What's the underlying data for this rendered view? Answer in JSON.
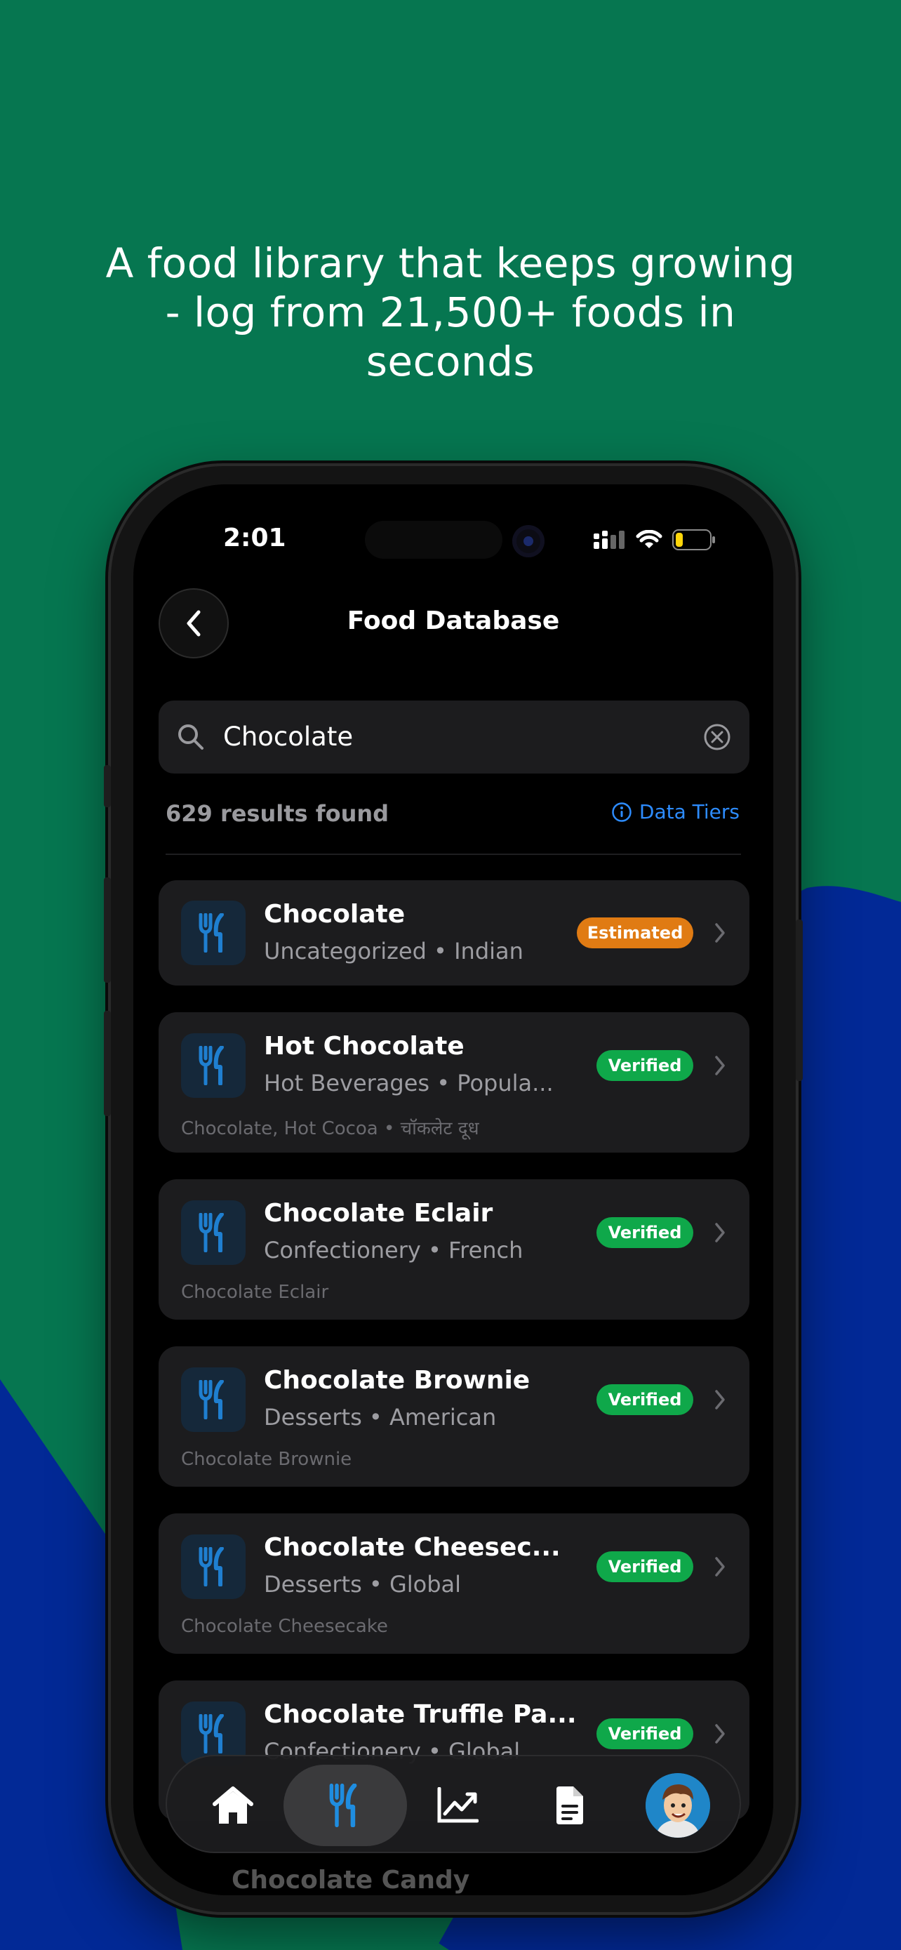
{
  "marketing": {
    "headline": "A food library that keeps growing - log from 21,500+ foods in seconds",
    "colors": {
      "green": "#067650",
      "blue": "#022996"
    }
  },
  "status_bar": {
    "time": "2:01"
  },
  "header": {
    "back_icon": "chevron-left-icon",
    "title": "Food Database"
  },
  "search": {
    "value": "Chocolate",
    "icon": "search-icon",
    "clear_icon": "clear-circle-icon"
  },
  "results": {
    "count_text": "629 results found",
    "data_tiers_label": "Data Tiers"
  },
  "foods": [
    {
      "name": "Chocolate",
      "subtitle": "Uncategorized • Indian",
      "alias": "",
      "badge": "Estimated",
      "badge_color": "#e07b13"
    },
    {
      "name": "Hot Chocolate",
      "subtitle": "Hot Beverages • Popula...",
      "alias": "Chocolate, Hot Cocoa • चॉकलेट दूध",
      "badge": "Verified",
      "badge_color": "#0fa84a"
    },
    {
      "name": "Chocolate Eclair",
      "subtitle": "Confectionery • French",
      "alias": "Chocolate Eclair",
      "badge": "Verified",
      "badge_color": "#0fa84a"
    },
    {
      "name": "Chocolate Brownie",
      "subtitle": "Desserts • American",
      "alias": "Chocolate Brownie",
      "badge": "Verified",
      "badge_color": "#0fa84a"
    },
    {
      "name": "Chocolate Cheesec...",
      "subtitle": "Desserts • Global",
      "alias": "Chocolate Cheesecake",
      "badge": "Verified",
      "badge_color": "#0fa84a"
    },
    {
      "name": "Chocolate Truffle Pa...",
      "subtitle": "Confectionery • Global",
      "alias": "",
      "badge": "Verified",
      "badge_color": "#0fa84a"
    }
  ],
  "peek_item": "Chocolate Candy",
  "tab_bar": {
    "items": [
      {
        "icon": "home-icon",
        "active": false
      },
      {
        "icon": "fork-knife-icon",
        "active": true
      },
      {
        "icon": "chart-icon",
        "active": false
      },
      {
        "icon": "document-icon",
        "active": false
      },
      {
        "icon": "avatar-icon",
        "active": false
      }
    ]
  }
}
